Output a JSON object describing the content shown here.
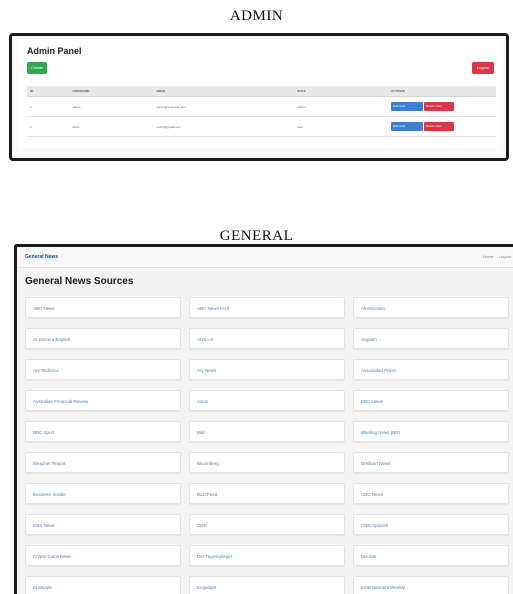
{
  "admin": {
    "caption": "ADMIN",
    "title": "Admin Panel",
    "create_label": "Create",
    "logout_label": "Logout",
    "columns": [
      "ID",
      "USERNAME",
      "EMAIL",
      "ROLE",
      "ACTIONS"
    ],
    "rows": [
      {
        "id": "1",
        "username": "admin",
        "email": "admin@example.com",
        "role": "admin",
        "edit": "Edit User",
        "delete": "Delete User"
      },
      {
        "id": "2",
        "username": "user1",
        "email": "user1@gmail.com",
        "role": "user",
        "edit": "Edit User",
        "delete": "Delete User"
      }
    ],
    "colors": {
      "create": "#2fa84f",
      "logout": "#dc3545",
      "edit": "#3c7fd6",
      "delete": "#dc3545"
    }
  },
  "general": {
    "caption": "GENERAL",
    "brand": "General News",
    "nav_links": [
      "Home",
      "Logout"
    ],
    "title": "General News Sources",
    "sources": [
      "ABC News",
      "ABC News (AU)",
      "Aftenposten",
      "Al Jazeera English",
      "ANSA.it",
      "Argaam",
      "Ars Technica",
      "Ary News",
      "Associated Press",
      "Australian Financial Review",
      "Axios",
      "BBC News",
      "BBC Sport",
      "Bild",
      "Blasting News (BR)",
      "Bleacher Report",
      "Bloomberg",
      "Breitbart News",
      "Business Insider",
      "BuzzFeed",
      "CBC News",
      "CBS News",
      "CNN",
      "CNN Spanish",
      "Crypto Coins News",
      "Der Tagesspiegel",
      "Die Zeit",
      "El Mundo",
      "Engadget",
      "Entertainment Weekly"
    ],
    "colors": {
      "brand": "#1a4fa0",
      "link": "#5a7fb5"
    }
  }
}
